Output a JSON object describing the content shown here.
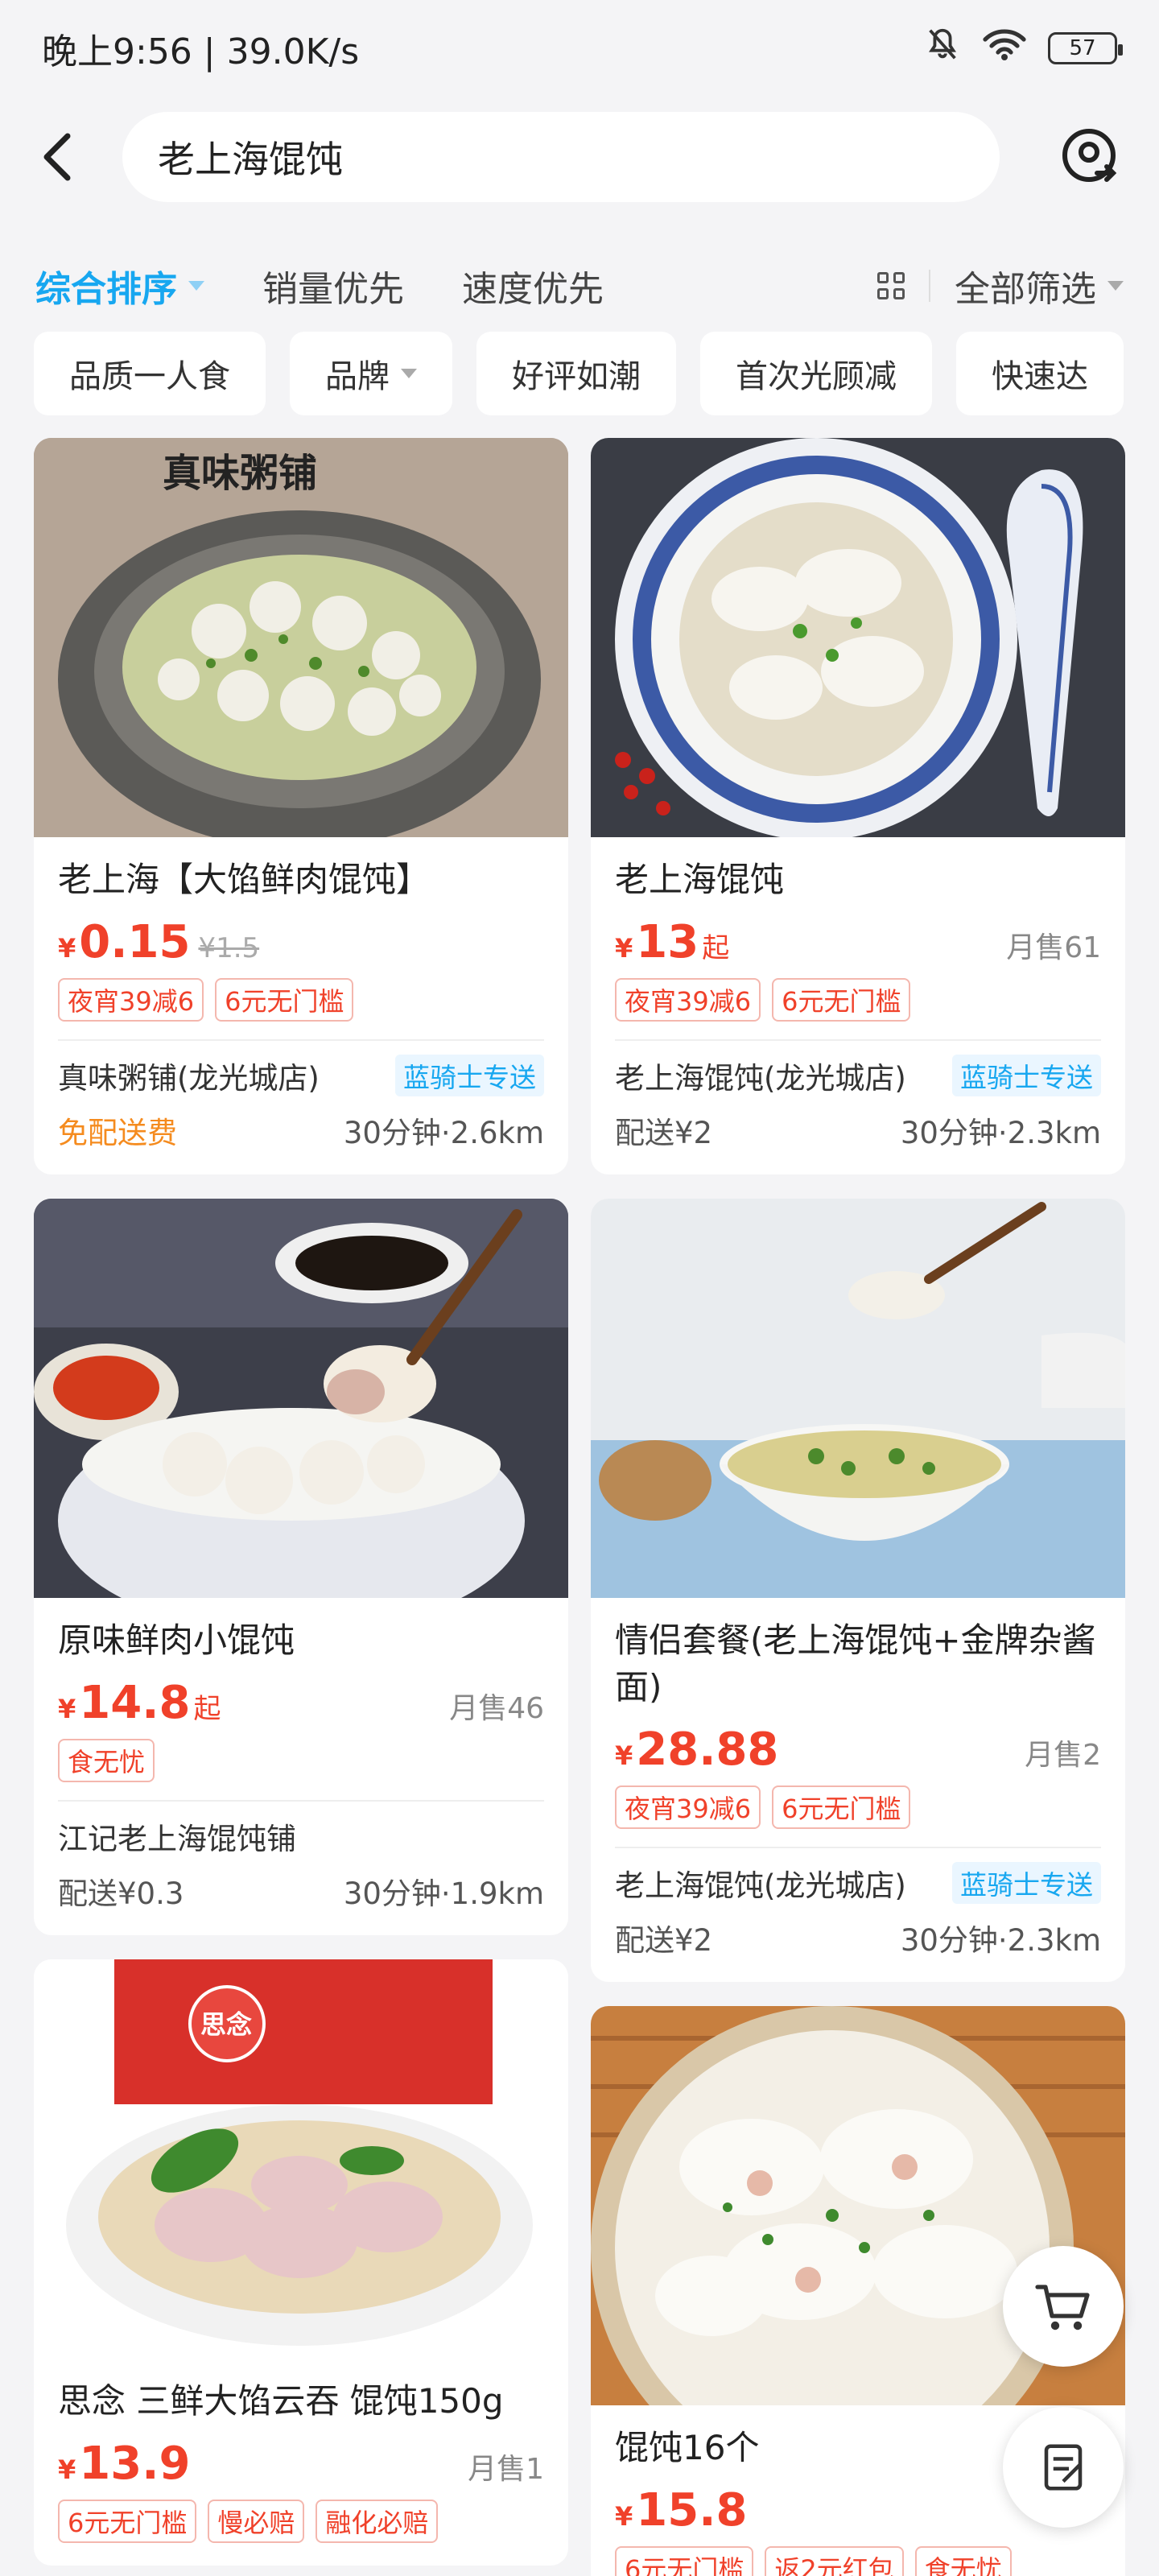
{
  "status_bar": {
    "time": "晚上9:56 | 39.0K/s",
    "battery": "57"
  },
  "search": {
    "query": "老上海馄饨"
  },
  "sort": {
    "options": [
      "综合排序",
      "销量优先",
      "速度优先"
    ],
    "filter_all": "全部筛选"
  },
  "chips": [
    "品质一人食",
    "品牌",
    "好评如潮",
    "首次光顾减",
    "快速达"
  ],
  "products": [
    {
      "title": "老上海【大馅鲜肉馄饨】",
      "yen": "¥",
      "price": "0.15",
      "orig": "¥1.5",
      "tags": [
        "夜宵39减6",
        "6元无门槛"
      ],
      "shop": "真味粥铺(龙光城店)",
      "rider": "蓝骑士专送",
      "delivery": "免配送费",
      "eta": "30分钟·2.6km",
      "img_text": "真味粥铺"
    },
    {
      "title": "老上海馄饨",
      "yen": "¥",
      "price": "13",
      "qi": "起",
      "sold": "月售61",
      "tags": [
        "夜宵39减6",
        "6元无门槛"
      ],
      "shop": "老上海馄饨(龙光城店)",
      "rider": "蓝骑士专送",
      "delivery": "配送¥2",
      "eta": "30分钟·2.3km"
    },
    {
      "title": "原味鲜肉小馄饨",
      "yen": "¥",
      "price": "14.8",
      "qi": "起",
      "sold": "月售46",
      "tags": [
        "食无忧"
      ],
      "shop": "江记老上海馄饨铺",
      "delivery": "配送¥0.3",
      "eta": "30分钟·1.9km"
    },
    {
      "title": "情侣套餐(老上海馄饨+金牌杂酱面)",
      "yen": "¥",
      "price": "28.88",
      "sold": "月售2",
      "tags": [
        "夜宵39减6",
        "6元无门槛"
      ],
      "shop": "老上海馄饨(龙光城店)",
      "rider": "蓝骑士专送",
      "delivery": "配送¥2",
      "eta": "30分钟·2.3km"
    },
    {
      "title": "思念  三鲜大馅云吞 馄饨150g",
      "yen": "¥",
      "price": "13.9",
      "sold": "月售1",
      "tags": [
        "6元无门槛",
        "慢必赔",
        "融化必赔"
      ],
      "img_text": "思念"
    },
    {
      "title": "馄饨16个",
      "yen": "¥",
      "price": "15.8",
      "tags": [
        "6元无门槛",
        "返2元红包",
        "食无忧"
      ]
    }
  ],
  "colors": {
    "accent": "#17a7f0",
    "price": "#f0412a",
    "free_delivery": "#f58b1e"
  }
}
